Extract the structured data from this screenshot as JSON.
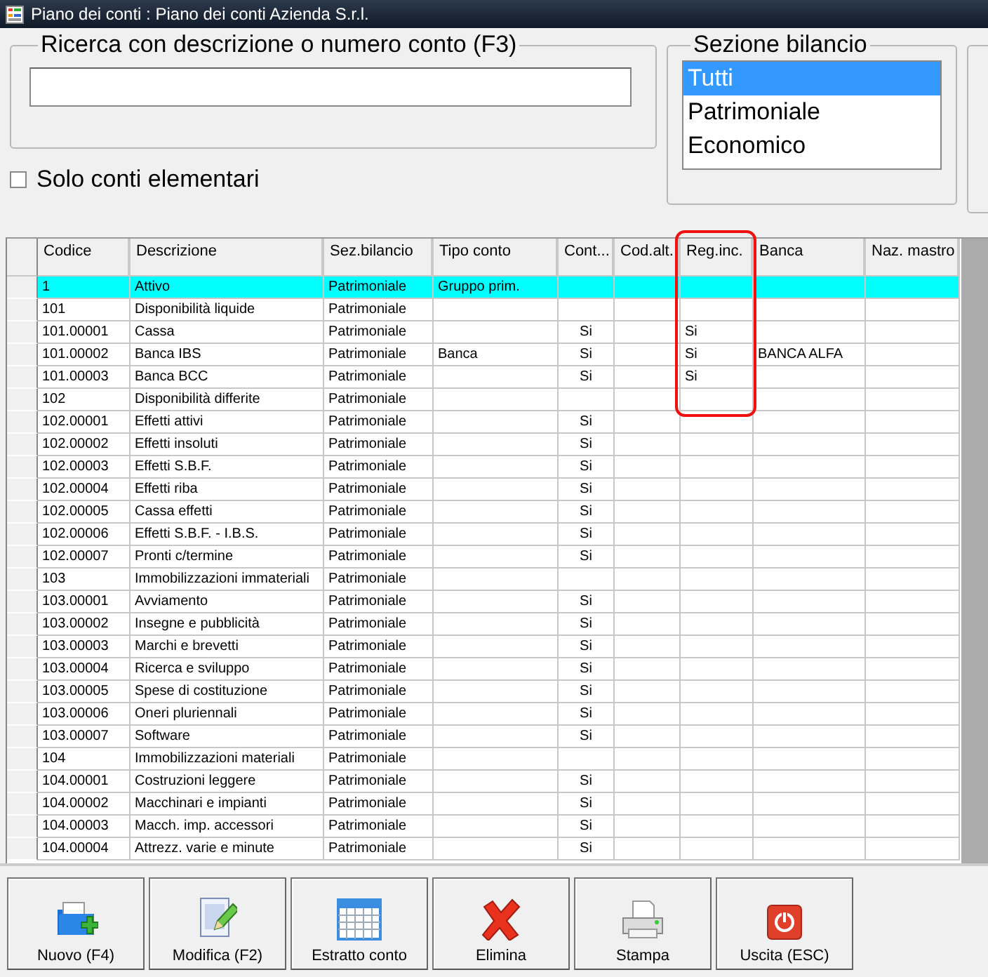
{
  "window": {
    "title": "Piano dei conti : Piano dei conti Azienda S.r.l."
  },
  "search": {
    "legend": "Ricerca con descrizione o numero conto (F3)"
  },
  "filter": {
    "label": "Solo conti elementari",
    "checked": false
  },
  "section": {
    "legend": "Sezione bilancio",
    "options": [
      {
        "label": "Tutti",
        "selected": true
      },
      {
        "label": "Patrimoniale",
        "selected": false
      },
      {
        "label": "Economico",
        "selected": false
      }
    ]
  },
  "table": {
    "columns": [
      {
        "label": "Codice",
        "highlighted": false
      },
      {
        "label": "Descrizione",
        "highlighted": false
      },
      {
        "label": "Sez.bilancio",
        "highlighted": false
      },
      {
        "label": "Tipo conto",
        "highlighted": false
      },
      {
        "label": "Cont...",
        "highlighted": false
      },
      {
        "label": "Cod.alt.",
        "highlighted": false
      },
      {
        "label": "Reg.inc.",
        "highlighted": true
      },
      {
        "label": "Banca",
        "highlighted": false
      },
      {
        "label": "Naz. mastro",
        "highlighted": false
      }
    ],
    "rows": [
      {
        "selected": true,
        "cells": [
          "1",
          "Attivo",
          "Patrimoniale",
          "Gruppo prim.",
          "",
          "",
          "",
          "",
          ""
        ]
      },
      {
        "selected": false,
        "cells": [
          "101",
          "Disponibilità liquide",
          "Patrimoniale",
          "",
          "",
          "",
          "",
          "",
          ""
        ]
      },
      {
        "selected": false,
        "cells": [
          "101.00001",
          "Cassa",
          "Patrimoniale",
          "",
          "Si",
          "",
          "Si",
          "",
          ""
        ]
      },
      {
        "selected": false,
        "cells": [
          "101.00002",
          "Banca IBS",
          "Patrimoniale",
          "Banca",
          "Si",
          "",
          "Si",
          "BANCA ALFA",
          ""
        ]
      },
      {
        "selected": false,
        "cells": [
          "101.00003",
          "Banca BCC",
          "Patrimoniale",
          "",
          "Si",
          "",
          "Si",
          "",
          ""
        ]
      },
      {
        "selected": false,
        "cells": [
          "102",
          "Disponibilità differite",
          "Patrimoniale",
          "",
          "",
          "",
          "",
          "",
          ""
        ]
      },
      {
        "selected": false,
        "cells": [
          "102.00001",
          "Effetti attivi",
          "Patrimoniale",
          "",
          "Si",
          "",
          "",
          "",
          ""
        ]
      },
      {
        "selected": false,
        "cells": [
          "102.00002",
          "Effetti insoluti",
          "Patrimoniale",
          "",
          "Si",
          "",
          "",
          "",
          ""
        ]
      },
      {
        "selected": false,
        "cells": [
          "102.00003",
          "Effetti S.B.F.",
          "Patrimoniale",
          "",
          "Si",
          "",
          "",
          "",
          ""
        ]
      },
      {
        "selected": false,
        "cells": [
          "102.00004",
          "Effetti riba",
          "Patrimoniale",
          "",
          "Si",
          "",
          "",
          "",
          ""
        ]
      },
      {
        "selected": false,
        "cells": [
          "102.00005",
          "Cassa effetti",
          "Patrimoniale",
          "",
          "Si",
          "",
          "",
          "",
          ""
        ]
      },
      {
        "selected": false,
        "cells": [
          "102.00006",
          "Effetti S.B.F. - I.B.S.",
          "Patrimoniale",
          "",
          "Si",
          "",
          "",
          "",
          ""
        ]
      },
      {
        "selected": false,
        "cells": [
          "102.00007",
          "Pronti c/termine",
          "Patrimoniale",
          "",
          "Si",
          "",
          "",
          "",
          ""
        ]
      },
      {
        "selected": false,
        "cells": [
          "103",
          "Immobilizzazioni immateriali",
          "Patrimoniale",
          "",
          "",
          "",
          "",
          "",
          ""
        ]
      },
      {
        "selected": false,
        "cells": [
          "103.00001",
          "Avviamento",
          "Patrimoniale",
          "",
          "Si",
          "",
          "",
          "",
          ""
        ]
      },
      {
        "selected": false,
        "cells": [
          "103.00002",
          "Insegne e pubblicità",
          "Patrimoniale",
          "",
          "Si",
          "",
          "",
          "",
          ""
        ]
      },
      {
        "selected": false,
        "cells": [
          "103.00003",
          "Marchi e brevetti",
          "Patrimoniale",
          "",
          "Si",
          "",
          "",
          "",
          ""
        ]
      },
      {
        "selected": false,
        "cells": [
          "103.00004",
          "Ricerca e sviluppo",
          "Patrimoniale",
          "",
          "Si",
          "",
          "",
          "",
          ""
        ]
      },
      {
        "selected": false,
        "cells": [
          "103.00005",
          "Spese di costituzione",
          "Patrimoniale",
          "",
          "Si",
          "",
          "",
          "",
          ""
        ]
      },
      {
        "selected": false,
        "cells": [
          "103.00006",
          "Oneri pluriennali",
          "Patrimoniale",
          "",
          "Si",
          "",
          "",
          "",
          ""
        ]
      },
      {
        "selected": false,
        "cells": [
          "103.00007",
          "Software",
          "Patrimoniale",
          "",
          "Si",
          "",
          "",
          "",
          ""
        ]
      },
      {
        "selected": false,
        "cells": [
          "104",
          "Immobilizzazioni materiali",
          "Patrimoniale",
          "",
          "",
          "",
          "",
          "",
          ""
        ]
      },
      {
        "selected": false,
        "cells": [
          "104.00001",
          "Costruzioni leggere",
          "Patrimoniale",
          "",
          "Si",
          "",
          "",
          "",
          ""
        ]
      },
      {
        "selected": false,
        "cells": [
          "104.00002",
          "Macchinari e impianti",
          "Patrimoniale",
          "",
          "Si",
          "",
          "",
          "",
          ""
        ]
      },
      {
        "selected": false,
        "cells": [
          "104.00003",
          "Macch. imp. accessori",
          "Patrimoniale",
          "",
          "Si",
          "",
          "",
          "",
          ""
        ]
      },
      {
        "selected": false,
        "cells": [
          "104.00004",
          "Attrezz. varie e minute",
          "Patrimoniale",
          "",
          "Si",
          "",
          "",
          "",
          ""
        ]
      }
    ]
  },
  "buttons": [
    {
      "label": "Nuovo (F4)",
      "kind": "new"
    },
    {
      "label": "Modifica (F2)",
      "kind": "edit"
    },
    {
      "label": "Estratto conto",
      "kind": "calendar"
    },
    {
      "label": "Elimina",
      "kind": "delete"
    },
    {
      "label": "Stampa",
      "kind": "print"
    },
    {
      "label": "Uscita (ESC)",
      "kind": "exit"
    }
  ]
}
